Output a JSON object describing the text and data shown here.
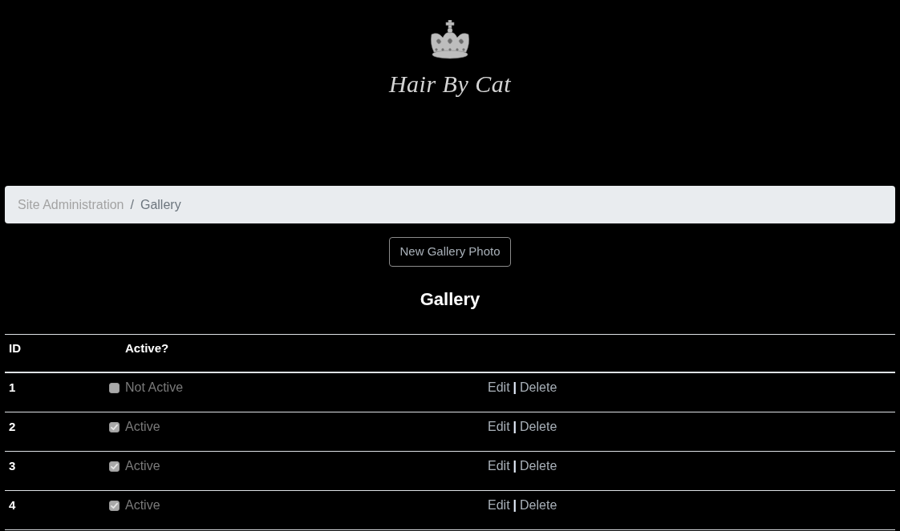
{
  "logo": {
    "text": "Hair By Cat"
  },
  "breadcrumb": {
    "separator": "/",
    "items": [
      {
        "label": "Site Administration",
        "current": false
      },
      {
        "label": "Gallery",
        "current": true
      }
    ]
  },
  "new_button": "New Gallery Photo",
  "heading": "Gallery",
  "table": {
    "columns": [
      "ID",
      "Active?"
    ],
    "rows": [
      {
        "id": "1",
        "checked": false,
        "status": "Not Active",
        "edit": "Edit",
        "separator": "|",
        "delete": "Delete"
      },
      {
        "id": "2",
        "checked": true,
        "status": "Active",
        "edit": "Edit",
        "separator": "|",
        "delete": "Delete"
      },
      {
        "id": "3",
        "checked": true,
        "status": "Active",
        "edit": "Edit",
        "separator": "|",
        "delete": "Delete"
      },
      {
        "id": "4",
        "checked": true,
        "status": "Active",
        "edit": "Edit",
        "separator": "|",
        "delete": "Delete"
      }
    ]
  }
}
